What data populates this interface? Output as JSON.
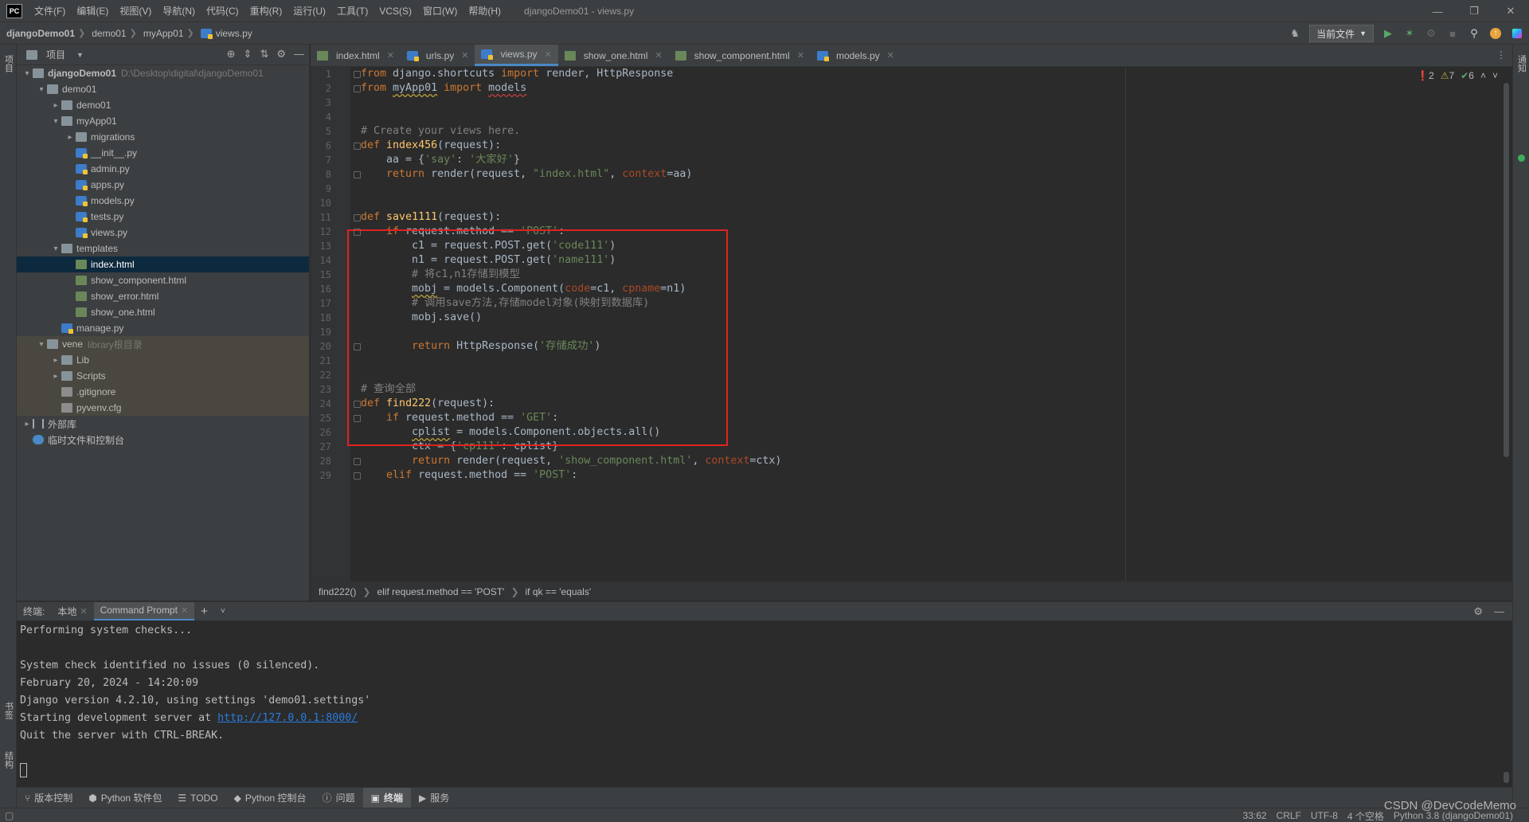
{
  "app": {
    "logo": "PC",
    "menu": [
      "文件(F)",
      "编辑(E)",
      "视图(V)",
      "导航(N)",
      "代码(C)",
      "重构(R)",
      "运行(U)",
      "工具(T)",
      "VCS(S)",
      "窗口(W)",
      "帮助(H)"
    ],
    "window_title": "djangoDemo01 - views.py"
  },
  "navbar": {
    "crumbs": [
      "djangoDemo01",
      "demo01",
      "myApp01",
      "views.py"
    ],
    "run_config": "当前文件"
  },
  "left_strip": {
    "project_tab": "项目",
    "bookmarks_tab": "书签",
    "structure_tab": "结构"
  },
  "right_strip": {
    "notifications_tab": "通知"
  },
  "project": {
    "title": "项目",
    "tree": [
      {
        "label": "djangoDemo01",
        "path": "D:\\Desktop\\digital\\djangoDemo01",
        "type": "folder",
        "level": 0,
        "expanded": true,
        "bold": true
      },
      {
        "label": "demo01",
        "type": "folder",
        "level": 1,
        "expanded": true
      },
      {
        "label": "demo01",
        "type": "folder",
        "level": 2,
        "expanded": false
      },
      {
        "label": "myApp01",
        "type": "folder",
        "level": 2,
        "expanded": true
      },
      {
        "label": "migrations",
        "type": "folder",
        "level": 3,
        "expanded": false
      },
      {
        "label": "__init__.py",
        "type": "py",
        "level": 3
      },
      {
        "label": "admin.py",
        "type": "py",
        "level": 3
      },
      {
        "label": "apps.py",
        "type": "py",
        "level": 3
      },
      {
        "label": "models.py",
        "type": "py",
        "level": 3
      },
      {
        "label": "tests.py",
        "type": "py",
        "level": 3
      },
      {
        "label": "views.py",
        "type": "py",
        "level": 3
      },
      {
        "label": "templates",
        "type": "folder",
        "level": 2,
        "expanded": true
      },
      {
        "label": "index.html",
        "type": "html",
        "level": 3,
        "selected": true
      },
      {
        "label": "show_component.html",
        "type": "html",
        "level": 3
      },
      {
        "label": "show_error.html",
        "type": "html",
        "level": 3
      },
      {
        "label": "show_one.html",
        "type": "html",
        "level": 3
      },
      {
        "label": "manage.py",
        "type": "py",
        "level": 2
      },
      {
        "label": "vene",
        "path": "library根目录",
        "type": "folder",
        "level": 1,
        "expanded": true,
        "lib": true
      },
      {
        "label": "Lib",
        "type": "folder",
        "level": 2,
        "expanded": false,
        "lib": true
      },
      {
        "label": "Scripts",
        "type": "folder",
        "level": 2,
        "expanded": false,
        "lib": true
      },
      {
        "label": ".gitignore",
        "type": "txt",
        "level": 2,
        "lib": true
      },
      {
        "label": "pyvenv.cfg",
        "type": "txt",
        "level": 2,
        "lib": true
      },
      {
        "label": "外部库",
        "type": "lib",
        "level": 0,
        "expanded": false
      },
      {
        "label": "临时文件和控制台",
        "type": "scratch",
        "level": 0
      }
    ]
  },
  "editor_tabs": [
    {
      "label": "index.html",
      "type": "html"
    },
    {
      "label": "urls.py",
      "type": "py"
    },
    {
      "label": "views.py",
      "type": "py",
      "active": true
    },
    {
      "label": "show_one.html",
      "type": "html"
    },
    {
      "label": "show_component.html",
      "type": "html"
    },
    {
      "label": "models.py",
      "type": "py"
    }
  ],
  "inspections": {
    "errors": "2",
    "warnings": "7",
    "ok": "6"
  },
  "code": [
    [
      [
        "kw",
        "from"
      ],
      [
        "t",
        " django.shortcuts "
      ],
      [
        "kw",
        "import"
      ],
      [
        "t",
        " render, HttpResponse"
      ]
    ],
    [
      [
        "kw",
        "from"
      ],
      [
        "t",
        " "
      ],
      [
        "ul",
        "myApp01"
      ],
      [
        "t",
        " "
      ],
      [
        "kw",
        "import"
      ],
      [
        "t",
        " "
      ],
      [
        "ulr",
        "models"
      ]
    ],
    [],
    [],
    [
      [
        "cmt",
        "# Create your views here."
      ]
    ],
    [
      [
        "kw",
        "def"
      ],
      [
        "t",
        " "
      ],
      [
        "fn",
        "index456"
      ],
      [
        "t",
        "(request):"
      ]
    ],
    [
      [
        "t",
        "    aa = {"
      ],
      [
        "str",
        "'say'"
      ],
      [
        "t",
        ": "
      ],
      [
        "str",
        "'大家好'"
      ],
      [
        "t",
        "}"
      ]
    ],
    [
      [
        "t",
        "    "
      ],
      [
        "kw",
        "return"
      ],
      [
        "t",
        " render(request, "
      ],
      [
        "str",
        "\"index.html\""
      ],
      [
        "t",
        ", "
      ],
      [
        "param",
        "context"
      ],
      [
        "t",
        "=aa)"
      ]
    ],
    [],
    [],
    [
      [
        "kw",
        "def"
      ],
      [
        "t",
        " "
      ],
      [
        "fn",
        "save1111"
      ],
      [
        "t",
        "(request):"
      ]
    ],
    [
      [
        "t",
        "    "
      ],
      [
        "kw",
        "if"
      ],
      [
        "t",
        " request.method == "
      ],
      [
        "str",
        "'POST'"
      ],
      [
        "t",
        ":"
      ]
    ],
    [
      [
        "t",
        "        c1 = request.POST.get("
      ],
      [
        "str",
        "'code111'"
      ],
      [
        "t",
        ")"
      ]
    ],
    [
      [
        "t",
        "        n1 = request.POST.get("
      ],
      [
        "str",
        "'name111'"
      ],
      [
        "t",
        ")"
      ]
    ],
    [
      [
        "t",
        "        "
      ],
      [
        "cmt",
        "# 将c1,n1存储到模型"
      ]
    ],
    [
      [
        "t",
        "        "
      ],
      [
        "ul",
        "mobj"
      ],
      [
        "t",
        " = models.Component("
      ],
      [
        "param",
        "code"
      ],
      [
        "t",
        "=c1, "
      ],
      [
        "param",
        "cpname"
      ],
      [
        "t",
        "=n1)"
      ]
    ],
    [
      [
        "t",
        "        "
      ],
      [
        "cmt",
        "# 调用save方法,存储model对象(映射到数据库)"
      ]
    ],
    [
      [
        "t",
        "        mobj.save()"
      ]
    ],
    [],
    [
      [
        "t",
        "        "
      ],
      [
        "kw",
        "return"
      ],
      [
        "t",
        " HttpResponse("
      ],
      [
        "str",
        "'存储成功'"
      ],
      [
        "t",
        ")"
      ]
    ],
    [],
    [],
    [
      [
        "cmt",
        "# 查询全部"
      ]
    ],
    [
      [
        "kw",
        "def"
      ],
      [
        "t",
        " "
      ],
      [
        "fn",
        "find222"
      ],
      [
        "t",
        "(request):"
      ]
    ],
    [
      [
        "t",
        "    "
      ],
      [
        "kw",
        "if"
      ],
      [
        "t",
        " request.method == "
      ],
      [
        "str",
        "'GET'"
      ],
      [
        "t",
        ":"
      ]
    ],
    [
      [
        "t",
        "        "
      ],
      [
        "ul",
        "cplist"
      ],
      [
        "t",
        " = models.Component.objects.all()"
      ]
    ],
    [
      [
        "t",
        "        ctx = {"
      ],
      [
        "str",
        "'cp111'"
      ],
      [
        "t",
        ": cplist}"
      ]
    ],
    [
      [
        "t",
        "        "
      ],
      [
        "kw",
        "return"
      ],
      [
        "t",
        " render(request, "
      ],
      [
        "str",
        "'show_component.html'"
      ],
      [
        "t",
        ", "
      ],
      [
        "param",
        "context"
      ],
      [
        "t",
        "=ctx)"
      ]
    ],
    [
      [
        "t",
        "    "
      ],
      [
        "kw",
        "elif"
      ],
      [
        "t",
        " request.method == "
      ],
      [
        "str",
        "'POST'"
      ],
      [
        "t",
        ":"
      ]
    ]
  ],
  "code_crumbs": [
    "find222()",
    "elif request.method == 'POST'",
    "if qk == 'equals'"
  ],
  "terminal": {
    "label": "终端:",
    "tabs": [
      {
        "label": "本地",
        "active": false
      },
      {
        "label": "Command Prompt",
        "active": true
      }
    ],
    "lines": [
      "Performing system checks...",
      "",
      "System check identified no issues (0 silenced).",
      "February 20, 2024 - 14:20:09",
      "Django version 4.2.10, using settings 'demo01.settings'",
      "Starting development server at ",
      "Quit the server with CTRL-BREAK."
    ],
    "link": "http://127.0.0.1:8000/"
  },
  "bottom_tools": [
    {
      "label": "版本控制",
      "icon": "branch-icon"
    },
    {
      "label": "Python 软件包",
      "icon": "package-icon"
    },
    {
      "label": "TODO",
      "icon": "todo-icon"
    },
    {
      "label": "Python 控制台",
      "icon": "python-console-icon"
    },
    {
      "label": "问题",
      "icon": "problems-icon"
    },
    {
      "label": "终端",
      "icon": "terminal-icon",
      "active": true
    },
    {
      "label": "服务",
      "icon": "services-icon"
    }
  ],
  "status": {
    "position": "33:62",
    "line_sep": "CRLF",
    "encoding": "UTF-8",
    "indent": "4 个空格",
    "interpreter": "Python 3.8 (djangoDemo01)"
  },
  "watermark": "CSDN @DevCodeMemo",
  "colors": {
    "accent": "#4a88c7",
    "highlight_box": "#e0221f",
    "keyword": "#cc7832",
    "string": "#6a8759"
  }
}
